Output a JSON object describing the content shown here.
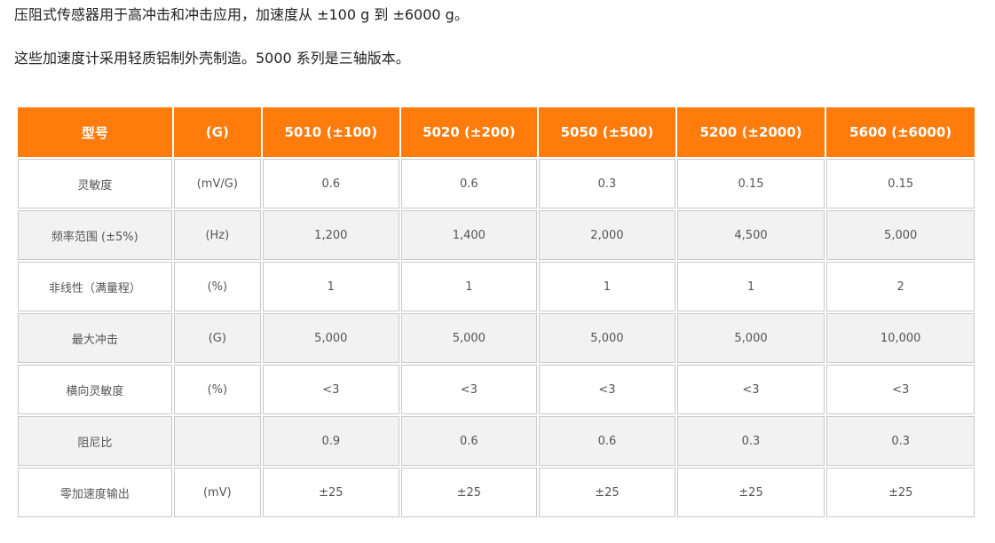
{
  "intro": {
    "line1": "压阻式传感器用于高冲击和冲击应用，加速度从 ±100 g 到 ±6000 g。",
    "line2": "这些加速度计采用轻质铝制外壳制造。5000 系列是三轴版本。"
  },
  "table": {
    "headers": [
      "型号",
      "(G)",
      "5010 (±100)",
      "5020 (±200)",
      "5050 (±500)",
      "5200 (±2000)",
      "5600 (±6000)"
    ],
    "rows": [
      [
        "灵敏度",
        "(mV/G)",
        "0.6",
        "0.6",
        "0.3",
        "0.15",
        "0.15"
      ],
      [
        "频率范围 (±5%)",
        "(Hz)",
        "1,200",
        "1,400",
        "2,000",
        "4,500",
        "5,000"
      ],
      [
        "非线性（满量程）",
        "(%)",
        "1",
        "1",
        "1",
        "1",
        "2"
      ],
      [
        "最大冲击",
        "(G)",
        "5,000",
        "5,000",
        "5,000",
        "5,000",
        "10,000"
      ],
      [
        "横向灵敏度",
        "(%)",
        "<3",
        "<3",
        "<3",
        "<3",
        "<3"
      ],
      [
        "阻尼比",
        "",
        "0.9",
        "0.6",
        "0.6",
        "0.3",
        "0.3"
      ],
      [
        "零加速度输出",
        "(mV)",
        "±25",
        "±25",
        "±25",
        "±25",
        "±25"
      ]
    ]
  },
  "colors": {
    "header_bg": "#ff7b0c",
    "header_text": "#ffffff",
    "alt_row_bg": "#f2f2f2",
    "cell_border": "#c8c8c8"
  }
}
